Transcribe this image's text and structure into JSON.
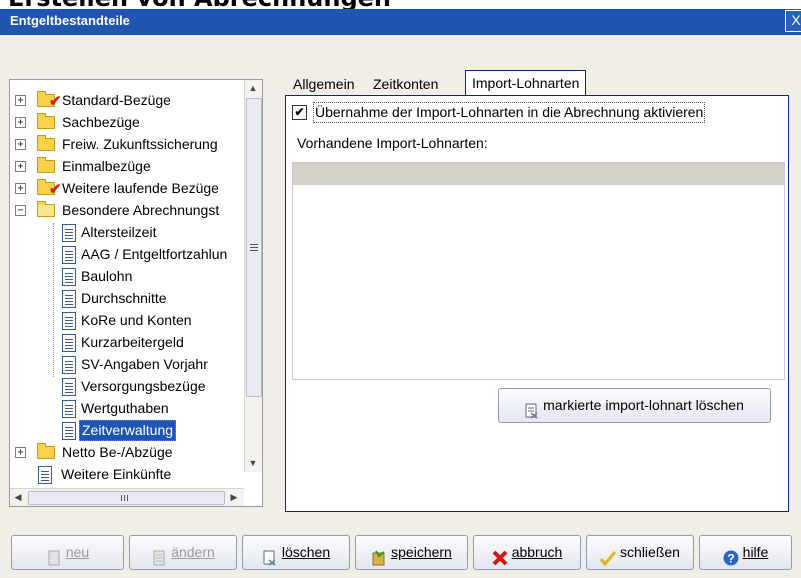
{
  "page": {
    "heading": "Erstellen von Abrechnungen"
  },
  "window": {
    "title": "Entgeltbestandteile",
    "close_glyph": "X"
  },
  "tree": {
    "items": [
      {
        "label": "Standard-Bezüge",
        "icon": "checked-folder-icon",
        "expander": "+"
      },
      {
        "label": "Sachbezüge",
        "icon": "folder-icon",
        "expander": "+"
      },
      {
        "label": "Freiw. Zukunftssicherung",
        "icon": "folder-icon",
        "expander": "+"
      },
      {
        "label": "Einmalbezüge",
        "icon": "folder-icon",
        "expander": "+"
      },
      {
        "label": "Weitere laufende Bezüge",
        "icon": "checked-folder-icon",
        "expander": "+"
      },
      {
        "label": "Besondere Abrechnungst",
        "icon": "open-folder-icon",
        "expander": "−"
      },
      {
        "label": "Altersteilzeit",
        "icon": "document-icon"
      },
      {
        "label": "AAG / Entgeltfortzahlun",
        "icon": "document-icon"
      },
      {
        "label": "Baulohn",
        "icon": "document-icon"
      },
      {
        "label": "Durchschnitte",
        "icon": "document-icon"
      },
      {
        "label": "KoRe und Konten",
        "icon": "document-icon"
      },
      {
        "label": "Kurzarbeitergeld",
        "icon": "document-icon"
      },
      {
        "label": "SV-Angaben Vorjahr",
        "icon": "document-icon"
      },
      {
        "label": "Versorgungsbezüge",
        "icon": "document-icon"
      },
      {
        "label": "Wertguthaben",
        "icon": "document-icon"
      },
      {
        "label": "Zeitverwaltung",
        "icon": "document-icon",
        "selected": true
      },
      {
        "label": "Netto Be-/Abzüge",
        "icon": "folder-icon",
        "expander": "+"
      },
      {
        "label": "Weitere Einkünfte",
        "icon": "document-icon"
      }
    ],
    "scroll_up": "▲",
    "scroll_down": "▼",
    "scroll_left": "◀",
    "scroll_right": "▶"
  },
  "tabs": [
    {
      "label": "Allgemein"
    },
    {
      "label": "Zeitkonten"
    },
    {
      "label": "Import-Lohnarten",
      "active": true
    }
  ],
  "import_tab": {
    "activate_label": "Übernahme der Import-Lohnarten in die Abrechnung aktivieren",
    "activate_checked": true,
    "checkmark": "✔",
    "list_label": "Vorhandene Import-Lohnarten:",
    "delete_button": "markierte import-lohnart löschen"
  },
  "toolbar": {
    "buttons": [
      {
        "label": "neu",
        "icon": "new-icon",
        "disabled": true
      },
      {
        "label": "ändern",
        "icon": "edit-icon",
        "disabled": true
      },
      {
        "label": "löschen",
        "icon": "delete-icon",
        "disabled": false
      },
      {
        "label": "speichern",
        "icon": "save-icon",
        "disabled": false
      },
      {
        "label": "abbruch",
        "icon": "cancel-icon",
        "disabled": false
      },
      {
        "label": "schließen",
        "icon": "close-check-icon",
        "disabled": false
      },
      {
        "label": "hilfe",
        "icon": "help-icon",
        "disabled": false
      }
    ]
  },
  "colors": {
    "titlebar": "#1f55b0",
    "selection": "#1f55b0",
    "tab_border": "#0a2780",
    "window_bg": "#f0eee7"
  }
}
